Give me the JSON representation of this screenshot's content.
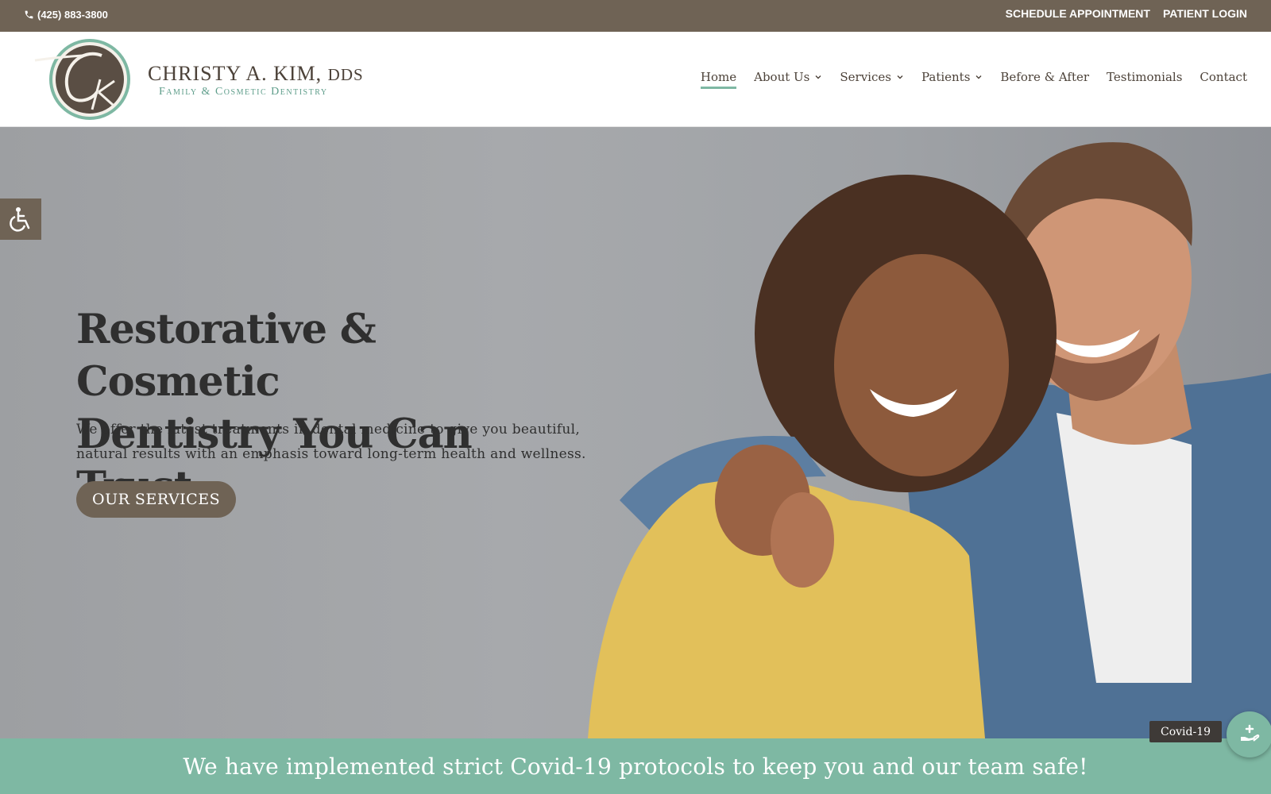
{
  "topbar": {
    "phone": "(425) 883-3800",
    "schedule": "SCHEDULE APPOINTMENT",
    "login": "PATIENT LOGIN"
  },
  "brand": {
    "name": "CHRISTY A. KIM,",
    "suffix": "DDS",
    "subtitle": "Family & Cosmetic Dentistry"
  },
  "nav": {
    "items": [
      {
        "label": "Home",
        "active": true,
        "dropdown": false
      },
      {
        "label": "About Us",
        "dropdown": true
      },
      {
        "label": "Services",
        "dropdown": true
      },
      {
        "label": "Patients",
        "dropdown": true
      },
      {
        "label": "Before & After",
        "dropdown": false
      },
      {
        "label": "Testimonials",
        "dropdown": false
      },
      {
        "label": "Contact",
        "dropdown": false
      }
    ]
  },
  "hero": {
    "title_line1": "Restorative & Cosmetic",
    "title_line2": "Dentistry You Can Trust",
    "text_line1": "We offer the latest treatments in dental medicine to give you beautiful,",
    "text_line2": "natural results with an emphasis toward long-term health and wellness.",
    "button": "OUR SERVICES"
  },
  "covid": {
    "banner": "We have implemented strict Covid-19 protocols to keep you and our team safe!",
    "tag": "Covid-19"
  },
  "icons": {
    "phone": "phone-icon",
    "accessibility": "wheelchair-icon",
    "covid_fab": "hand-care-icon",
    "chevron": "chevron-down-icon"
  },
  "colors": {
    "brand_brown": "#6f6355",
    "accent_green": "#7eb8a3",
    "text_dark": "#2f2f2f"
  }
}
